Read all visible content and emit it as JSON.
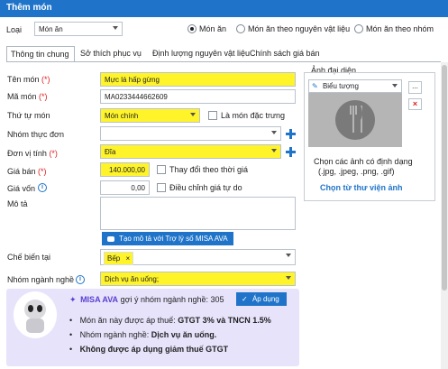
{
  "window": {
    "title": "Thêm món"
  },
  "type_row": {
    "label": "Loại",
    "selected": "Món ăn",
    "radios": [
      "Món ăn",
      "Món ăn theo nguyên vật liệu",
      "Món ăn theo nhóm"
    ],
    "selected_radio": 0
  },
  "tabs": [
    "Thông tin chung",
    "Sở thích phục vụ",
    "Định lượng nguyên vật liệu",
    "Chính sách giá bán"
  ],
  "active_tab": 0,
  "form": {
    "name_label": "Tên món",
    "name_value": "Mực lá hấp gừng",
    "code_label": "Mã món",
    "code_value": "MA0233444662609",
    "order_label": "Thứ tự món",
    "order_value": "Món chính",
    "special_label": "Là món đặc trưng",
    "menu_group_label": "Nhóm thực đơn",
    "menu_group_value": "",
    "unit_label": "Đơn vị tính",
    "unit_value": "Đĩa",
    "price_label": "Giá bán",
    "price_value": "140.000,00",
    "price_change_label": "Thay đổi theo thời giá",
    "cost_label": "Giá vốn",
    "cost_value": "0,00",
    "cost_adjust_label": "Điều chỉnh giá tự do",
    "desc_label": "Mô tả",
    "desc_value": "",
    "misa_desc_button": "Tạo mô tả với Trợ lý số MISA AVA",
    "processing_label": "Chế biến tại",
    "processing_tag": "Bếp",
    "industry_label": "Nhóm ngành nghề",
    "industry_value": "Dịch vụ ăn uống;"
  },
  "image_panel": {
    "title": "Ảnh đại diện",
    "icon_button": "Biểu tượng",
    "more_button": "...",
    "hint_line1": "Chọn các ảnh có định dạng",
    "hint_line2": "(.jpg, .jpeg, .png, .gif)",
    "library_link": "Chọn từ thư viện ảnh"
  },
  "ava": {
    "brand": "MISA AVA",
    "suggest_text": "gợi ý nhóm ngành nghề: 305",
    "apply_button": "Áp dụng",
    "bullet1_prefix": "Món ăn này được áp thuế:",
    "bullet1_bold": "GTGT 3% và TNCN 1.5%",
    "bullet2_prefix": "Nhóm ngành nghề:",
    "bullet2_bold": "Dịch vụ ăn uống.",
    "bullet3_bold": "Không được áp dụng giảm thuế GTGT"
  },
  "colors": {
    "accent": "#1f74c9",
    "highlight": "#fff42a",
    "required": "#e02020",
    "ava_bg": "#e7e3fb"
  }
}
